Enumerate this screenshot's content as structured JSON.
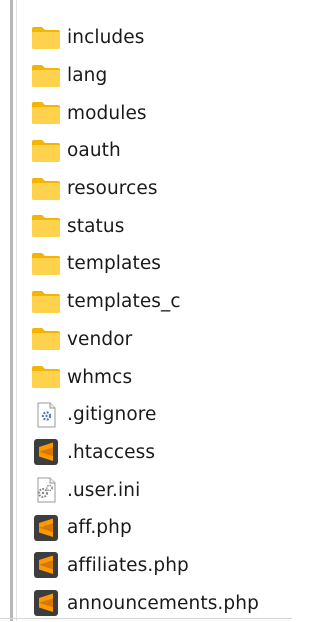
{
  "file_explorer": {
    "items": [
      {
        "name": "includes",
        "type": "folder",
        "icon": "folder-icon"
      },
      {
        "name": "lang",
        "type": "folder",
        "icon": "folder-icon"
      },
      {
        "name": "modules",
        "type": "folder",
        "icon": "folder-icon"
      },
      {
        "name": "oauth",
        "type": "folder",
        "icon": "folder-icon"
      },
      {
        "name": "resources",
        "type": "folder",
        "icon": "folder-icon"
      },
      {
        "name": "status",
        "type": "folder",
        "icon": "folder-icon"
      },
      {
        "name": "templates",
        "type": "folder",
        "icon": "folder-icon"
      },
      {
        "name": "templates_c",
        "type": "folder",
        "icon": "folder-icon"
      },
      {
        "name": "vendor",
        "type": "folder",
        "icon": "folder-icon"
      },
      {
        "name": "whmcs",
        "type": "folder",
        "icon": "folder-icon"
      },
      {
        "name": ".gitignore",
        "type": "file",
        "icon": "gear-file-icon"
      },
      {
        "name": ".htaccess",
        "type": "file",
        "icon": "sublime-text-icon"
      },
      {
        "name": ".user.ini",
        "type": "file",
        "icon": "settings-file-icon"
      },
      {
        "name": "aff.php",
        "type": "file",
        "icon": "sublime-text-icon"
      },
      {
        "name": "affiliates.php",
        "type": "file",
        "icon": "sublime-text-icon"
      },
      {
        "name": "announcements.php",
        "type": "file",
        "icon": "sublime-text-icon"
      }
    ]
  },
  "colors": {
    "folder_body": "#ffd24d",
    "folder_tab": "#f4b400",
    "sublime_bg": "#3d3d3d",
    "sublime_mark": "#ff9800",
    "text": "#1a1a1a"
  }
}
